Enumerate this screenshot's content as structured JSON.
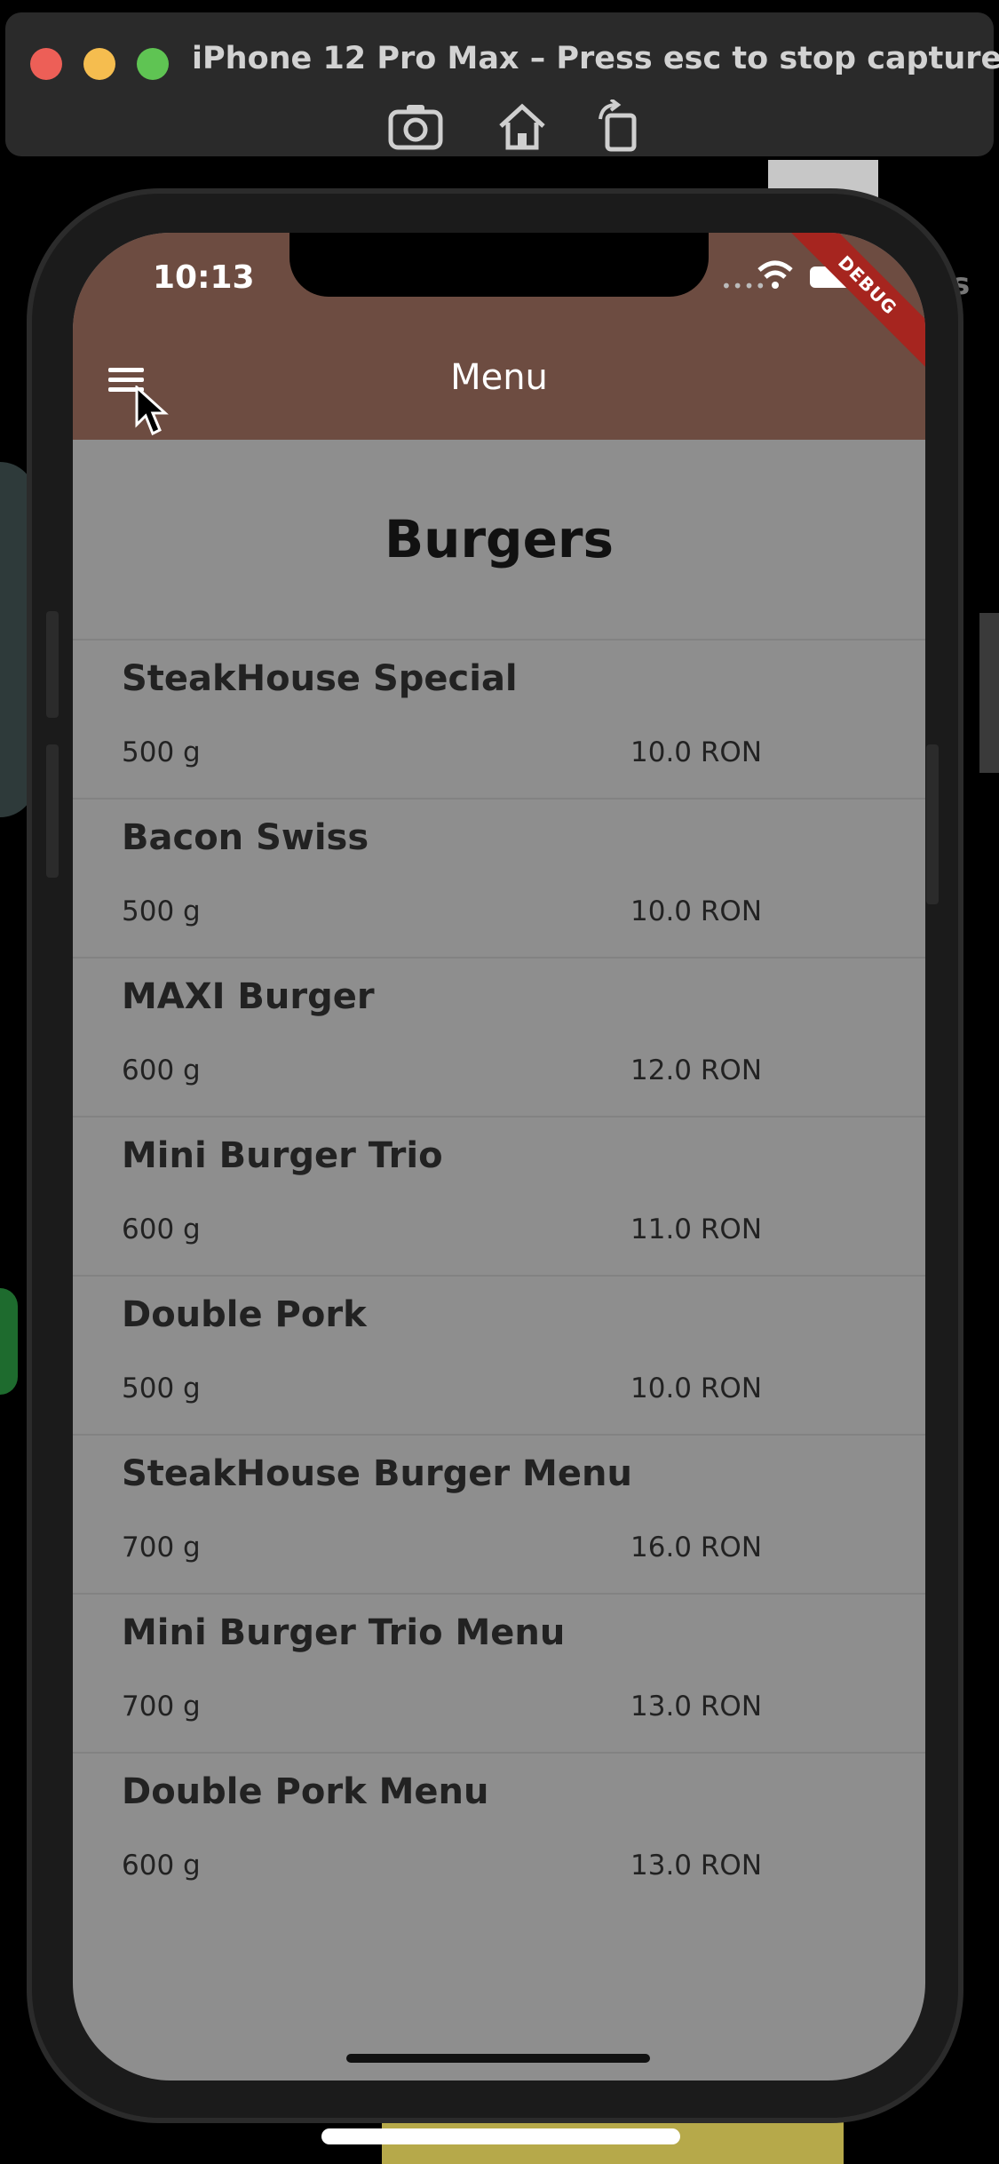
{
  "capture": {
    "title": "iPhone 12 Pro Max – Press esc to stop capture",
    "icons": [
      "camera-icon",
      "home-icon",
      "rotate-icon"
    ]
  },
  "status_bar": {
    "time": "10:13",
    "debug_label": "DEBUG"
  },
  "app_bar": {
    "title": "Menu",
    "menu_icon": "hamburger-menu-icon",
    "color": "#6d4c41"
  },
  "section": {
    "title": "Burgers"
  },
  "items": [
    {
      "name": "SteakHouse Special",
      "weight": "500 g",
      "price": "10.0 RON"
    },
    {
      "name": "Bacon Swiss",
      "weight": "500 g",
      "price": "10.0 RON"
    },
    {
      "name": "MAXI Burger",
      "weight": "600 g",
      "price": "12.0 RON"
    },
    {
      "name": "Mini Burger Trio",
      "weight": "600 g",
      "price": "11.0 RON"
    },
    {
      "name": "Double Pork",
      "weight": "500 g",
      "price": "10.0 RON"
    },
    {
      "name": "SteakHouse Burger Menu",
      "weight": "700 g",
      "price": "16.0 RON"
    },
    {
      "name": "Mini Burger Trio Menu",
      "weight": "700 g",
      "price": "13.0 RON"
    },
    {
      "name": "Double Pork Menu",
      "weight": "600 g",
      "price": "13.0 RON"
    }
  ],
  "background_fragment_text": "s"
}
